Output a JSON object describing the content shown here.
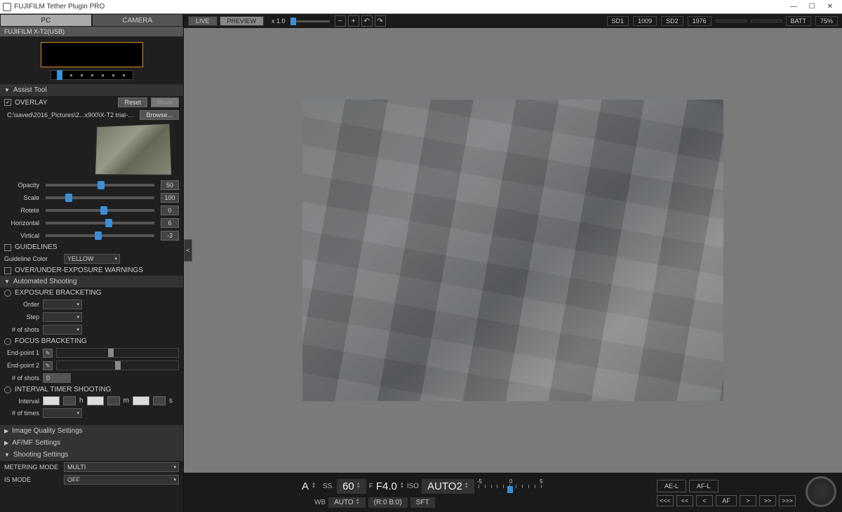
{
  "window": {
    "title": "FUJIFILM Tether Plugin PRO"
  },
  "tabs": {
    "pc": "PC",
    "camera": "CAMERA"
  },
  "camera_name": "FUJIFILM X-T2(USB)",
  "assist_tool": {
    "header": "Assist Tool",
    "overlay_label": "OVERLAY",
    "reset": "Reset",
    "move": "Move",
    "path": "C:\\saved\\2016_Pictures\\2...x900\\X-T2 trial-169s.jpg",
    "browse": "Browse...",
    "opacity": {
      "label": "Opacity",
      "value": "50",
      "pos": 48
    },
    "scale": {
      "label": "Scale",
      "value": "100",
      "pos": 18
    },
    "rotate": {
      "label": "Rotete",
      "value": "0",
      "pos": 50
    },
    "horizontal": {
      "label": "Horizontal",
      "value": "6",
      "pos": 55
    },
    "vertical": {
      "label": "Virtical",
      "value": "-3",
      "pos": 45
    },
    "guidelines": "GUIDELINES",
    "guideline_color_label": "Guideline Color",
    "guideline_color": "YELLOW",
    "warnings": "OVER/UNDER-EXPOSURE WARNINGS"
  },
  "automated": {
    "header": "Automated Shooting",
    "exp_bracket": "EXPOSURE BRACKETING",
    "order": "Order",
    "step": "Step",
    "shots": "# of shots",
    "focus_bracket": "FOCUS BRACKETING",
    "endpoint1": "End-point 1",
    "endpoint2": "End-point 2",
    "interval_hdr": "INTERVAL TIMER SHOOTING",
    "interval": "Interval",
    "h": "h",
    "m": "m",
    "s": "s",
    "times": "# of times"
  },
  "sections": {
    "image_quality": "Image Quality Settings",
    "afmf": "AF/MF Settings",
    "shooting": "Shooting Settings"
  },
  "shooting_settings": {
    "metering_label": "METERING MODE",
    "metering_value": "MULTI",
    "is_label": "IS MODE",
    "is_value": "OFF"
  },
  "topbar": {
    "live": "LIVE",
    "preview": "PREVIEW",
    "zoom": "x 1.0",
    "sd1": "SD1",
    "sd1v": "1009",
    "sd2": "SD2",
    "sd2v": "1976",
    "batt": "BATT",
    "battv": "75%"
  },
  "bottom": {
    "mode": "A",
    "ss_label": "SS.",
    "ss_value": "60",
    "f_label": "F",
    "f_value": "F4.0",
    "iso_label": "ISO",
    "iso_value": "AUTO2",
    "comp_min": "-5",
    "comp_zero": "0",
    "comp_max": "5",
    "wb_label": "WB",
    "wb_value": "AUTO",
    "wb_shift": "(R:0 B:0)",
    "sft": "SFT",
    "ael": "AE-L",
    "afl": "AF-L",
    "af": "AF",
    "nav": {
      "first": "<<<",
      "prev2": "<<",
      "prev": "<",
      "next": ">",
      "next2": ">>",
      "last": ">>>"
    }
  }
}
